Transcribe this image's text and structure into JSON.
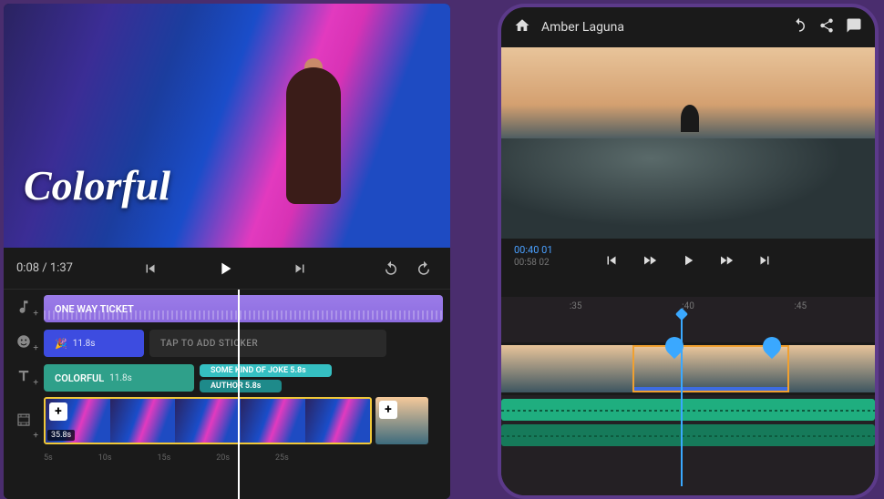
{
  "left": {
    "overlayTitle": "Colorful",
    "playback": {
      "current": "0:08",
      "total": "1:37"
    },
    "tracks": {
      "music": {
        "title": "ONE WAY TICKET"
      },
      "sticker": {
        "duration": "11.8s",
        "placeholder": "TAP TO ADD STICKER"
      },
      "text": {
        "main": "COLORFUL",
        "mainDur": "11.8s",
        "sub1": "SOME KIND OF JOKE",
        "sub1Dur": "5.8s",
        "sub2": "AUTHOR",
        "sub2Dur": "5.8s"
      },
      "video": {
        "duration": "35.8s"
      }
    },
    "ruler": [
      "5s",
      "10s",
      "15s",
      "20s",
      "25s"
    ]
  },
  "right": {
    "projectName": "Amber Laguna",
    "playback": {
      "current": "00:40",
      "frame": "01",
      "total": "00:58",
      "totalFrame": "02"
    },
    "ruler": [
      ":35",
      ":40",
      ":45"
    ]
  }
}
